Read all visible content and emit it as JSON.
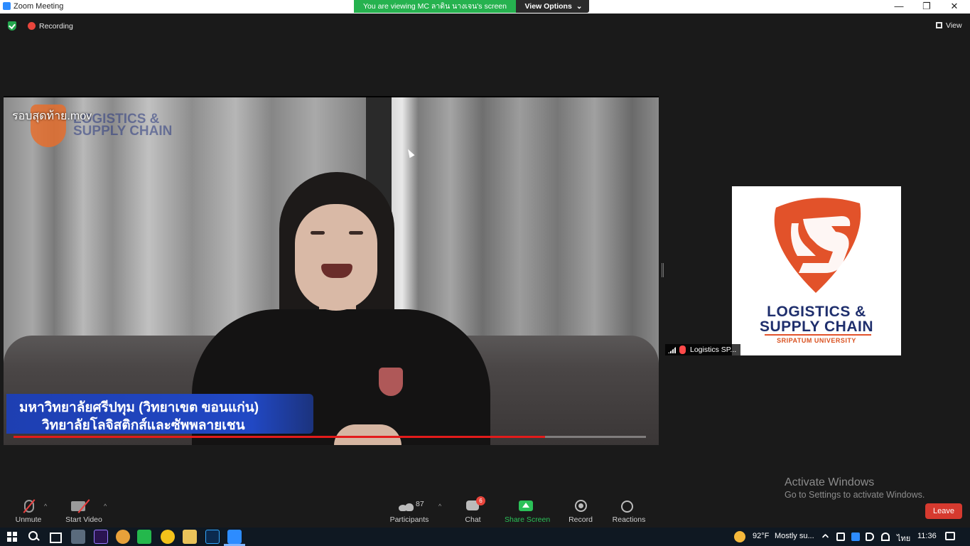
{
  "window": {
    "title": "Zoom Meeting",
    "controls": {
      "minimize": "—",
      "restore": "❐",
      "close": "✕"
    }
  },
  "banner": {
    "viewing": "You are viewing MC ลาดิน นางเจน's screen",
    "view_options": "View Options",
    "view_options_caret": "⌄"
  },
  "status": {
    "recording": "Recording",
    "view": "View"
  },
  "shared_screen": {
    "file_name": "รอบสุดท้าย.mov",
    "video_logo_text": "LOGISTICS & SUPPLY CHAIN",
    "caption_line1": "มหาวิทยาลัยศรีปทุม (วิทยาเขต ขอนแก่น)",
    "caption_line2": "วิทยาลัยโลจิสติกส์และซัพพลายเชน",
    "playback_progress": 0.84
  },
  "participant": {
    "logo_line1": "LOGISTICS &",
    "logo_line2": "SUPPLY CHAIN",
    "logo_line3": "SRIPATUM UNIVERSITY",
    "name": "Logistics SP..."
  },
  "watermark": {
    "title": "Activate Windows",
    "subtitle": "Go to Settings to activate Windows."
  },
  "toolbar": {
    "unmute": "Unmute",
    "start_video": "Start Video",
    "participants": "Participants",
    "participants_count": "87",
    "chat": "Chat",
    "chat_badge": "6",
    "share_screen": "Share Screen",
    "record": "Record",
    "reactions": "Reactions",
    "caret": "^",
    "leave": "Leave"
  },
  "taskbar": {
    "temperature": "92°F",
    "weather": "Mostly su...",
    "language": "ไทย",
    "clock": "11:36"
  },
  "colors": {
    "accent_green": "#26b24f",
    "leave_red": "#d63a2f",
    "brand_orange": "#e2522a",
    "brand_navy": "#1f2f6d"
  },
  "icons": [
    "zoom-icon",
    "shield-icon",
    "record-dot-icon",
    "view-grid-icon",
    "mic-muted-icon",
    "video-off-icon",
    "participants-icon",
    "chat-icon",
    "share-screen-icon",
    "record-icon",
    "reactions-icon",
    "windows-start-icon",
    "search-icon",
    "task-view-icon",
    "weather-icon",
    "notifications-icon"
  ]
}
